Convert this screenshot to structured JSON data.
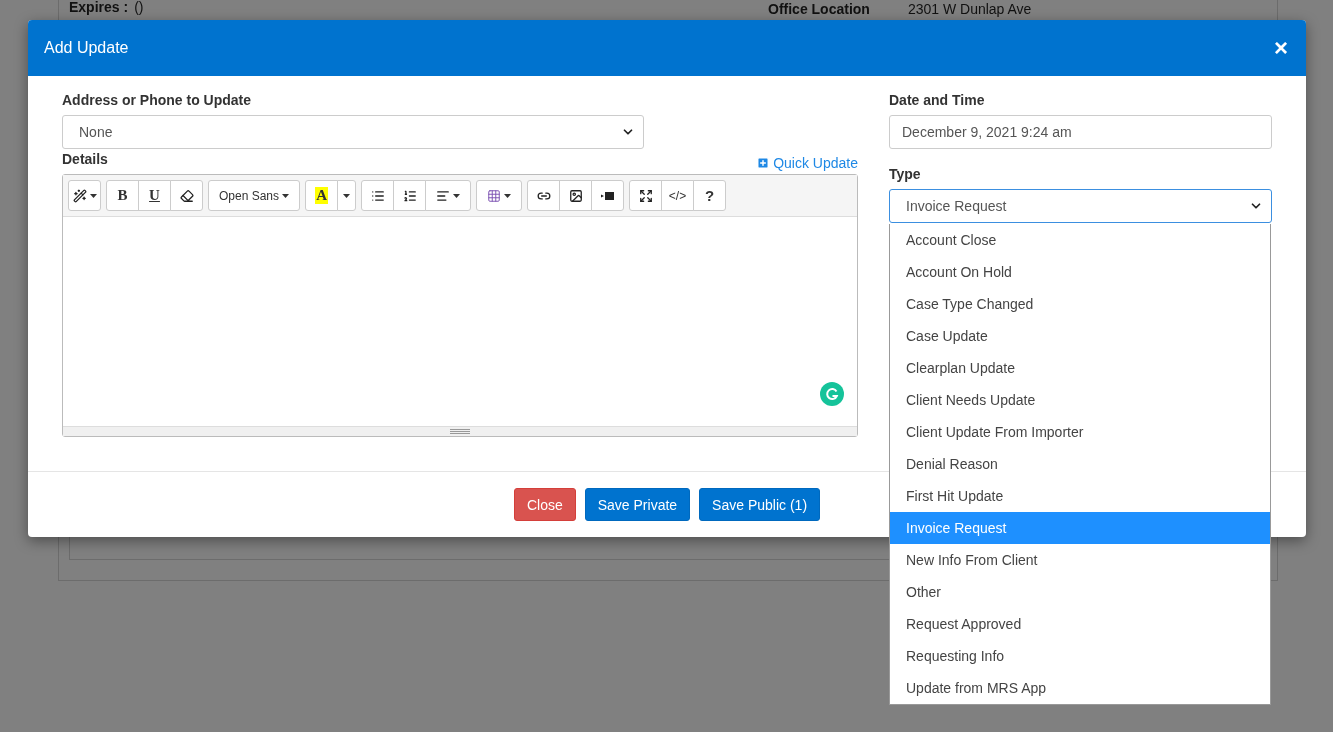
{
  "background_page": {
    "expires_label": "Expires :",
    "expires_value": "()",
    "office_location_label": "Office Location",
    "office_location_value": "2301 W Dunlap Ave"
  },
  "modal": {
    "title": "Add Update",
    "close": "×",
    "address_field": {
      "label": "Address or Phone to Update",
      "value": "None"
    },
    "details": {
      "label": "Details",
      "quick_update": "Quick Update",
      "toolbar": [
        [
          {
            "kind": "magic"
          }
        ],
        [
          {
            "kind": "bold",
            "label": "B"
          },
          {
            "kind": "underline",
            "label": "U"
          },
          {
            "kind": "eraser"
          }
        ],
        [
          {
            "kind": "font",
            "label": "Open Sans"
          }
        ],
        [
          {
            "kind": "color",
            "label": "A"
          },
          {
            "kind": "caret"
          }
        ],
        [
          {
            "kind": "ul"
          },
          {
            "kind": "ol"
          },
          {
            "kind": "align"
          }
        ],
        [
          {
            "kind": "table"
          }
        ],
        [
          {
            "kind": "link"
          },
          {
            "kind": "image"
          },
          {
            "kind": "video"
          }
        ],
        [
          {
            "kind": "fullscreen"
          },
          {
            "kind": "code",
            "label": "</>"
          },
          {
            "kind": "help",
            "label": "?"
          }
        ]
      ]
    },
    "date_field": {
      "label": "Date and Time",
      "value": "December 9, 2021 9:24 am"
    },
    "type_field": {
      "label": "Type",
      "value": "Invoice Request",
      "expanded": true,
      "options": [
        {
          "label": "Account Close",
          "selected": false
        },
        {
          "label": "Account On Hold",
          "selected": false
        },
        {
          "label": "Case Type Changed",
          "selected": false
        },
        {
          "label": "Case Update",
          "selected": false
        },
        {
          "label": "Clearplan Update",
          "selected": false
        },
        {
          "label": "Client Needs Update",
          "selected": false
        },
        {
          "label": "Client Update From Importer",
          "selected": false
        },
        {
          "label": "Denial Reason",
          "selected": false
        },
        {
          "label": "First Hit Update",
          "selected": false
        },
        {
          "label": "Invoice Request",
          "selected": true
        },
        {
          "label": "New Info From Client",
          "selected": false
        },
        {
          "label": "Other",
          "selected": false
        },
        {
          "label": "Request Approved",
          "selected": false
        },
        {
          "label": "Requesting Info",
          "selected": false
        },
        {
          "label": "Update from MRS App",
          "selected": false
        }
      ]
    },
    "buttons": [
      {
        "kind": "danger",
        "label": "Close"
      },
      {
        "kind": "primary",
        "label": "Save Private"
      },
      {
        "kind": "primary",
        "label": "Save Public (1)"
      }
    ]
  }
}
